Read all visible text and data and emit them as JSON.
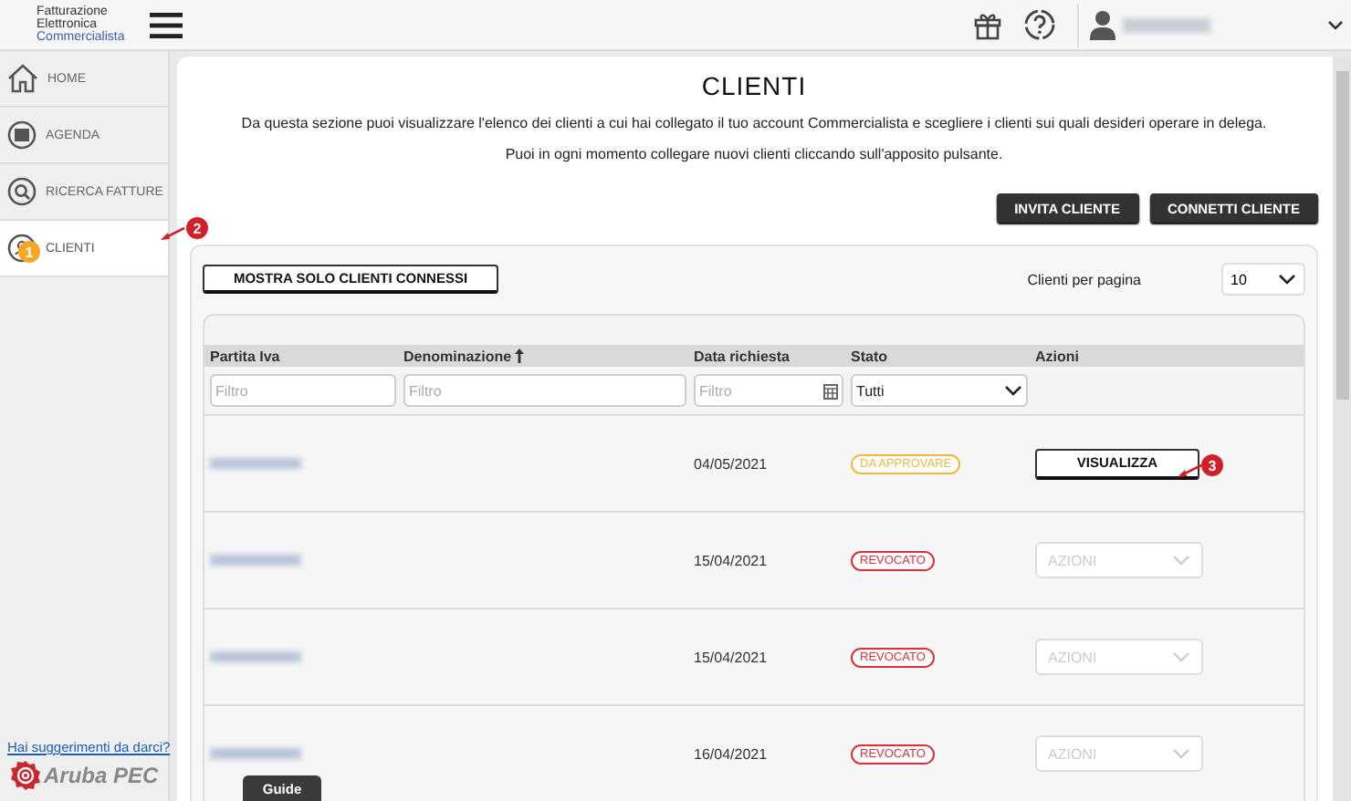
{
  "header": {
    "logo_lines": [
      "Fatturazione",
      "Elettronica",
      "Commercialista"
    ]
  },
  "sidebar": {
    "items": [
      {
        "label": "HOME",
        "selected": false
      },
      {
        "label": "AGENDA",
        "selected": false
      },
      {
        "label": "RICERCA FATTURE",
        "selected": false
      },
      {
        "label": "CLIENTI",
        "selected": true
      }
    ],
    "link": "Hai suggerimenti da darci?",
    "brand": "Aruba PEC"
  },
  "page": {
    "title": "CLIENTI",
    "paragraphs": [
      "Da questa sezione puoi visualizzare l'elenco dei clienti a cui hai collegato il tuo account Commercialista e scegliere i clienti sui quali desideri operare in delega.",
      "Puoi in ogni momento collegare nuovi clienti cliccando sull'apposito pulsante."
    ],
    "buttons": [
      "INVITA CLIENTE",
      "CONNETTI CLIENTE"
    ]
  },
  "panel": {
    "filter_button": "MOSTRA SOLO CLIENTI CONNESSI",
    "per_page_label": "Clienti per pagina",
    "per_page": "10"
  },
  "table": {
    "columns": [
      {
        "label": "Partita Iva",
        "sorted": false
      },
      {
        "label": "Denominazione",
        "sorted": true
      },
      {
        "label": "Data richiesta",
        "sorted": false
      },
      {
        "label": "Stato",
        "sorted": false
      },
      {
        "label": "Azioni",
        "sorted": false
      }
    ],
    "filters": [
      {
        "kind": "text",
        "placeholder": "Filtro"
      },
      {
        "kind": "text",
        "placeholder": "Filtro"
      },
      {
        "kind": "date",
        "placeholder": "Filtro"
      },
      {
        "kind": "select",
        "value": "Tutti"
      }
    ],
    "rows": [
      {
        "date": "04/05/2021",
        "status": "DA APPROVARE",
        "color": "#f0b840",
        "action": {
          "kind": "button",
          "label": "VISUALIZZA",
          "disabled": false
        }
      },
      {
        "date": "15/04/2021",
        "status": "REVOCATO",
        "color": "#d9303a",
        "action": {
          "kind": "select",
          "label": "AZIONI",
          "disabled": true
        }
      },
      {
        "date": "15/04/2021",
        "status": "REVOCATO",
        "color": "#d9303a",
        "action": {
          "kind": "select",
          "label": "AZIONI",
          "disabled": true
        }
      },
      {
        "date": "16/04/2021",
        "status": "REVOCATO",
        "color": "#d9303a",
        "action": {
          "kind": "select",
          "label": "AZIONI",
          "disabled": true
        }
      }
    ]
  },
  "callouts": [
    {
      "label": "1",
      "color": "#f5a623"
    },
    {
      "label": "2",
      "color": "#d0202a"
    },
    {
      "label": "3",
      "color": "#d0202a"
    }
  ],
  "guide": "Guide"
}
